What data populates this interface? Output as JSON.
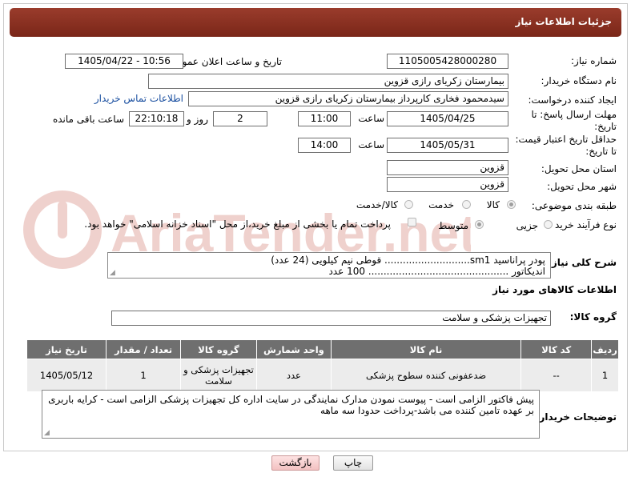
{
  "header": {
    "title": "جزئیات اطلاعات نیاز"
  },
  "fields": {
    "need_number_label": "شماره نیاز:",
    "need_number": "1105005428000280",
    "announce_label": "تاریخ و ساعت اعلان عمومی:",
    "announce_value": "1405/04/22 - 10:56",
    "buyer_org_label": "نام دستگاه خریدار:",
    "buyer_org": "بیمارستان زکریای رازی قزوین",
    "requester_label": "ایجاد کننده درخواست:",
    "requester": "سیدمحمود فخاری کارپرداز بیمارستان زکریای رازی قزوین",
    "contact_link": "اطلاعات تماس خریدار",
    "deadline_label_1": "مهلت ارسال پاسخ: تا",
    "deadline_label_2": "تاریخ:",
    "deadline_date": "1405/04/25",
    "time_label": "ساعت",
    "deadline_time": "11:00",
    "days_value": "2",
    "days_label": "روز و",
    "remaining_time": "22:10:18",
    "remaining_label": "ساعت باقی مانده",
    "price_label_1": "حداقل تاریخ اعتبار قیمت:",
    "price_label_2": "تا تاریخ:",
    "price_date": "1405/05/31",
    "price_time": "14:00",
    "province_label": "استان محل تحویل:",
    "province": "قزوین",
    "city_label": "شهر محل تحویل:",
    "city": "قزوین",
    "category_label": "طبقه بندی موضوعی:",
    "cat_goods": "کالا",
    "cat_service": "خدمت",
    "cat_goods_service": "کالا/خدمت",
    "process_label": "نوع فرآیند خرید :",
    "proc_partial": "جزیی",
    "proc_medium": "متوسط",
    "payment_note": "پرداخت تمام یا بخشی از مبلغ خرید،از محل \"اسناد خزانه اسلامی\" خواهد بود."
  },
  "description": {
    "label": "شرح کلی نیاز:",
    "line1": "پودر پراناسید sm1............................     قوطی نیم کیلویی (24 عدد)",
    "line2": "اندیکاتور .............................................. 100 عدد"
  },
  "goods_section": {
    "title": "اطلاعات کالاهای مورد نیاز",
    "group_label": "گروه کالا:",
    "group_value": "تجهیزات پزشکی و سلامت"
  },
  "table": {
    "headers": [
      "ردیف",
      "کد کالا",
      "نام کالا",
      "واحد شمارش",
      "گروه کالا",
      "تعداد / مقدار",
      "تاریخ نیاز"
    ],
    "rows": [
      [
        "1",
        "--",
        "ضدعفونی کننده سطوح پزشکی",
        "عدد",
        "تجهیزات پزشکی و سلامت",
        "1",
        "1405/05/12"
      ]
    ]
  },
  "buyer_notes": {
    "label": "توضیحات خریدار:",
    "text": "پیش فاکتور الزامی است - پیوست نمودن مدارک نمایندگی در سایت اداره کل تجهیزات پزشکی الزامی است - کرایه باربری بر عهده تامین کننده می باشد-پرداخت حدودا سه ماهه"
  },
  "buttons": {
    "print": "چاپ",
    "back": "بازگشت"
  },
  "watermark_text": "AriaTender.net",
  "colors": {
    "header": "#8a3020",
    "table_header": "#6f6f6f",
    "link": "#1a4fa0"
  },
  "icons": [
    "radio-button",
    "checkbox-icon",
    "resize-grip-icon",
    "watermark-logo-icon"
  ]
}
